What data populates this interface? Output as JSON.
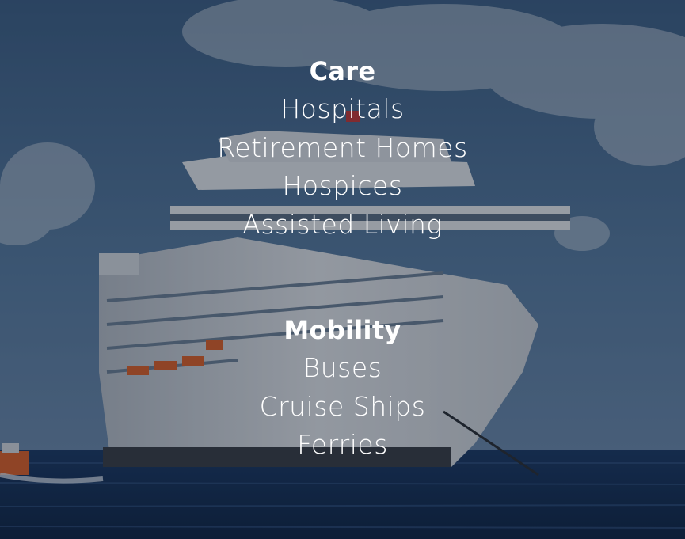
{
  "sections": [
    {
      "heading": "Care",
      "items": [
        "Hospitals",
        "Retirement Homes",
        "Hospices",
        "Assisted Living"
      ]
    },
    {
      "heading": "Mobility",
      "items": [
        "Buses",
        "Cruise Ships",
        "Ferries"
      ]
    }
  ],
  "background": {
    "sky_color": "#4f7399",
    "sea_color": "#1a3a6a",
    "ship_color": "#d8dde4",
    "tender_boat_color": "#e0632a"
  }
}
